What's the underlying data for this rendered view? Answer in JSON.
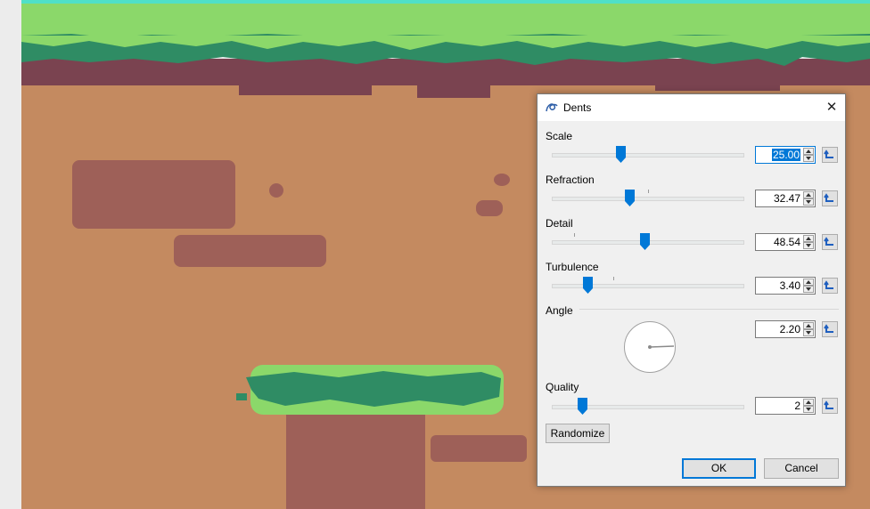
{
  "dialog": {
    "title": "Dents",
    "controls": [
      {
        "label": "Scale",
        "value": "25.00",
        "fraction": 0.36
      },
      {
        "label": "Refraction",
        "value": "32.47",
        "fraction": 0.41
      },
      {
        "label": "Detail",
        "value": "48.54",
        "fraction": 0.49
      },
      {
        "label": "Turbulence",
        "value": "3.40",
        "fraction": 0.19
      }
    ],
    "angle": {
      "label": "Angle",
      "value": "2.20"
    },
    "quality": {
      "label": "Quality",
      "value": "2",
      "fraction": 0.16
    },
    "randomize_label": "Randomize",
    "ok_label": "OK",
    "cancel_label": "Cancel"
  },
  "colors": {
    "accent": "#0078d7",
    "dirt": "#c48a60",
    "dirt_dark": "#9e6058",
    "soil_edge": "#7a4350",
    "grass_light": "#8bd86a",
    "grass_dark": "#2f8c64",
    "sky": "#4fe0c8"
  }
}
